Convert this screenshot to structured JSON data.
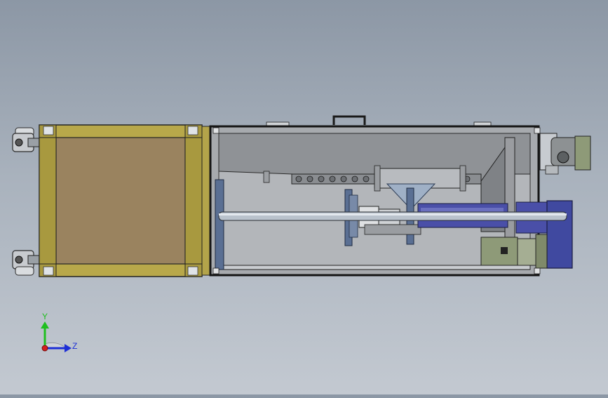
{
  "viewport": {
    "background_top": "#8c97a5",
    "background_bottom": "#c3c9d1"
  },
  "model": {
    "colors": {
      "frame_yellow": "#b8a84a",
      "frame_dark": "#1b1b1b",
      "panel_brown": "#9a835f",
      "housing_gray": "#a7aaae",
      "blue_part": "#5a6f93",
      "steel_blue": "#9fb0c6",
      "motor_purple": "#4a4fa8",
      "motor_green": "#8e9a78"
    }
  },
  "triad": {
    "y_label": "Y",
    "z_label": "Z",
    "y_color": "#1fbf1f",
    "z_color": "#1d2fd6",
    "x_color": "#d21f1f"
  }
}
